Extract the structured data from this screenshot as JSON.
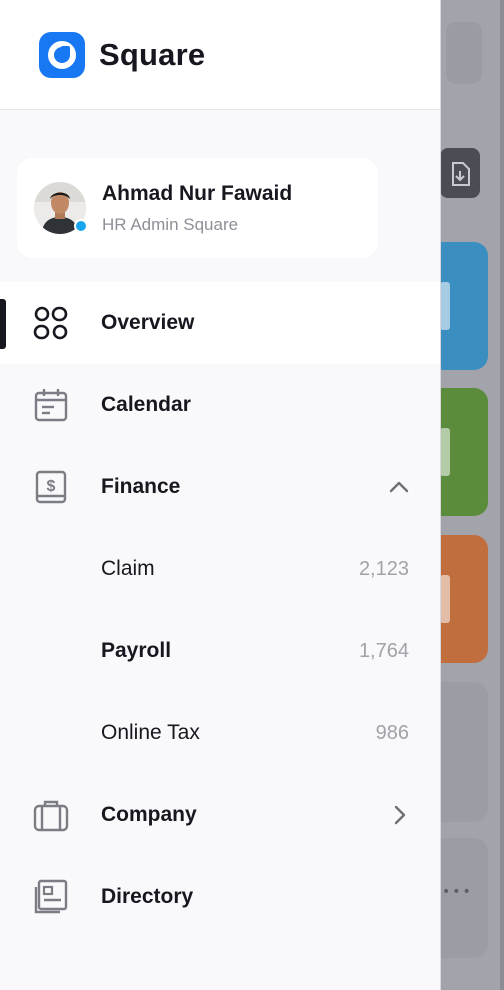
{
  "brand": {
    "name": "Square",
    "color": "#1877f2"
  },
  "profile": {
    "name": "Ahmad Nur Fawaid",
    "role": "HR Admin Square",
    "status_color": "#1aa6ee"
  },
  "nav": {
    "overview": {
      "label": "Overview",
      "icon": "grid-icon",
      "active": true
    },
    "calendar": {
      "label": "Calendar",
      "icon": "calendar-icon"
    },
    "finance": {
      "label": "Finance",
      "icon": "finance-icon",
      "expanded": true,
      "children": [
        {
          "label": "Claim",
          "count": "2,123"
        },
        {
          "label": "Payroll",
          "count": "1,764"
        },
        {
          "label": "Online Tax",
          "count": "986"
        }
      ]
    },
    "company": {
      "label": "Company",
      "icon": "briefcase-icon"
    },
    "directory": {
      "label": "Directory",
      "icon": "directory-icon"
    }
  },
  "background": {
    "card_colors": [
      "#3a8fc0",
      "#5a8c3c",
      "#c06e3e"
    ],
    "dots": "•••"
  }
}
